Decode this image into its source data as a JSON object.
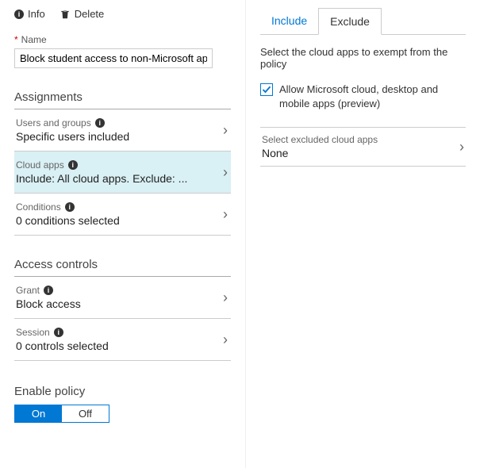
{
  "toolbar": {
    "info": "Info",
    "delete": "Delete"
  },
  "name": {
    "label": "Name",
    "value": "Block student access to non-Microsoft apps"
  },
  "assignments": {
    "heading": "Assignments",
    "rows": [
      {
        "label": "Users and groups",
        "value": "Specific users included"
      },
      {
        "label": "Cloud apps",
        "value": "Include: All cloud apps. Exclude: ..."
      },
      {
        "label": "Conditions",
        "value": "0 conditions selected"
      }
    ]
  },
  "access": {
    "heading": "Access controls",
    "rows": [
      {
        "label": "Grant",
        "value": "Block access"
      },
      {
        "label": "Session",
        "value": "0 controls selected"
      }
    ]
  },
  "enable": {
    "heading": "Enable policy",
    "on": "On",
    "off": "Off"
  },
  "tabs": {
    "include": "Include",
    "exclude": "Exclude"
  },
  "right": {
    "desc": "Select the cloud apps to exempt from the policy",
    "checkbox": "Allow Microsoft cloud, desktop and mobile apps (preview)",
    "sel_label": "Select excluded cloud apps",
    "sel_value": "None"
  }
}
